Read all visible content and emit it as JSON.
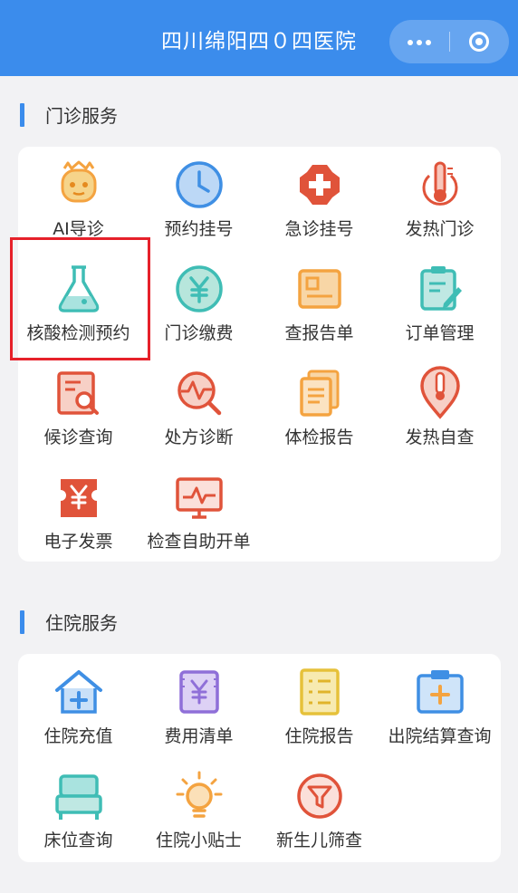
{
  "header": {
    "title": "四川绵阳四０四医院",
    "more_icon": "more-dots-icon",
    "close_icon": "target-icon"
  },
  "outpatient": {
    "title": "门诊服务",
    "items": [
      {
        "label": "AI导诊",
        "icon": "ai-robot-icon"
      },
      {
        "label": "预约挂号",
        "icon": "clock-icon"
      },
      {
        "label": "急诊挂号",
        "icon": "emergency-cross-icon"
      },
      {
        "label": "发热门诊",
        "icon": "thermometer-icon"
      },
      {
        "label": "核酸检测预约",
        "icon": "flask-icon"
      },
      {
        "label": "门诊缴费",
        "icon": "yen-circle-icon"
      },
      {
        "label": "查报告单",
        "icon": "report-card-icon"
      },
      {
        "label": "订单管理",
        "icon": "edit-clipboard-icon"
      },
      {
        "label": "候诊查询",
        "icon": "document-search-icon"
      },
      {
        "label": "处方诊断",
        "icon": "pulse-search-icon"
      },
      {
        "label": "体检报告",
        "icon": "stacked-documents-icon"
      },
      {
        "label": "发热自查",
        "icon": "location-thermometer-icon"
      },
      {
        "label": "电子发票",
        "icon": "yen-ticket-icon"
      },
      {
        "label": "检查自助开单",
        "icon": "monitor-pulse-icon"
      }
    ]
  },
  "inpatient": {
    "title": "住院服务",
    "items": [
      {
        "label": "住院充值",
        "icon": "house-plus-icon"
      },
      {
        "label": "费用清单",
        "icon": "yen-bill-icon"
      },
      {
        "label": "住院报告",
        "icon": "checklist-icon"
      },
      {
        "label": "出院结算查询",
        "icon": "medical-kit-icon"
      },
      {
        "label": "床位查询",
        "icon": "bed-icon"
      },
      {
        "label": "住院小贴士",
        "icon": "lightbulb-icon"
      },
      {
        "label": "新生儿筛查",
        "icon": "funnel-circle-icon"
      }
    ]
  },
  "colors": {
    "header": "#3b8cec",
    "highlight_box": "#e6212a",
    "orange": "#f4a340",
    "blue": "#3f8fe4",
    "red": "#e0533a",
    "teal": "#3fbdb5",
    "purple": "#8f6fd8"
  }
}
